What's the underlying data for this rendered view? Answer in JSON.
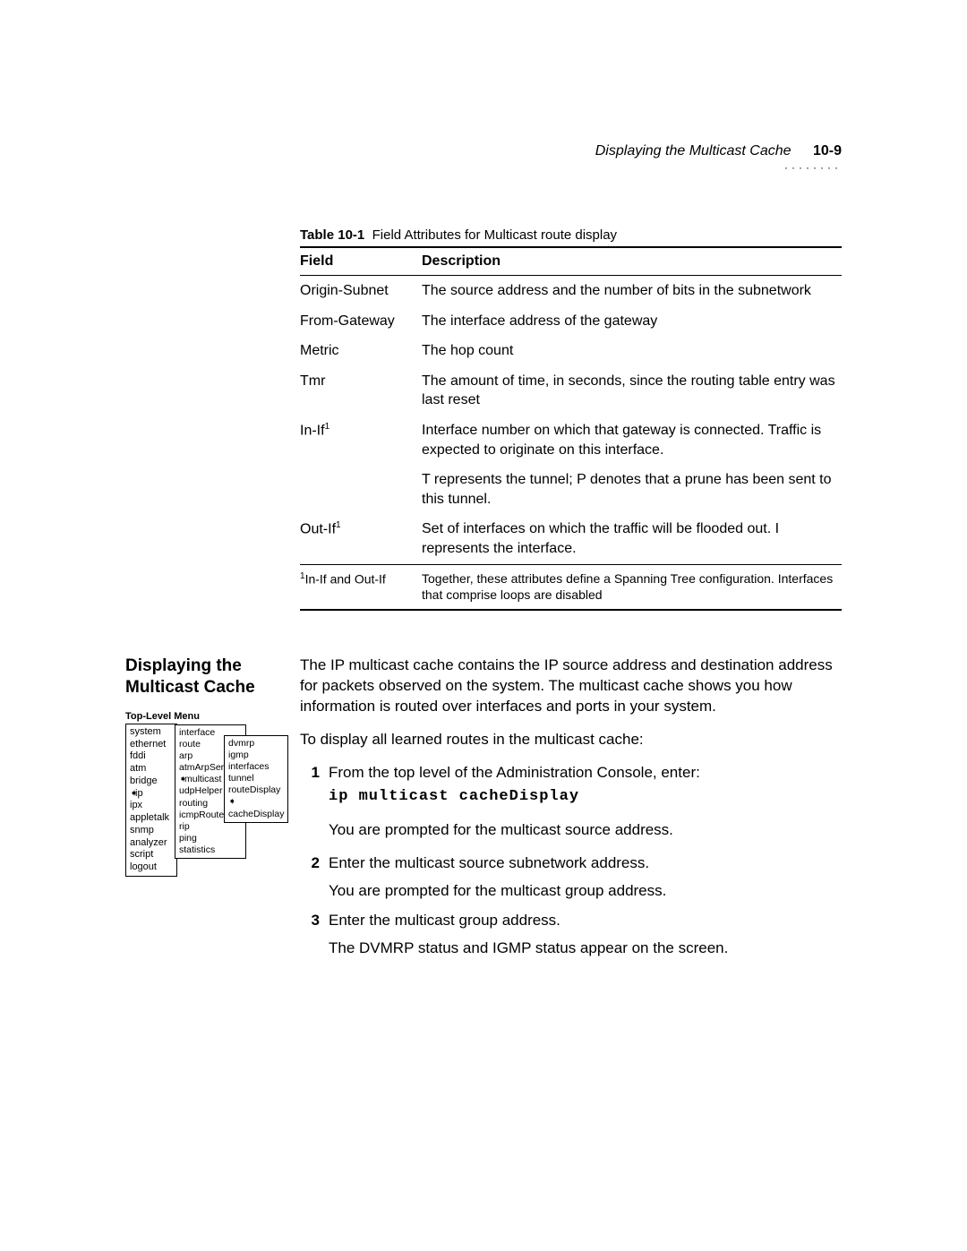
{
  "header": {
    "running": "Displaying the Multicast Cache",
    "page": "10-9",
    "dots": "········"
  },
  "table": {
    "label": "Table 10-1",
    "caption": "Field Attributes for Multicast route display",
    "head_field": "Field",
    "head_desc": "Description",
    "rows": [
      {
        "field": "Origin-Subnet",
        "desc": "The source address and the number of bits in the subnetwork"
      },
      {
        "field": "From-Gateway",
        "desc": "The interface address of the gateway"
      },
      {
        "field": "Metric",
        "desc": "The hop count"
      },
      {
        "field": "Tmr",
        "desc": "The amount of time, in seconds, since the routing table entry was last reset"
      },
      {
        "field": "In-If",
        "sup": "1",
        "desc": "Interface number on which that gateway is connected. Traffic is expected to originate on this interface."
      },
      {
        "field": "",
        "desc": "T represents the tunnel; P denotes that a prune has been sent to this tunnel."
      },
      {
        "field": "Out-If",
        "sup": "1",
        "desc": "Set of interfaces on which the traffic will be flooded out. I represents the interface."
      }
    ],
    "footnote_sup": "1",
    "footnote_field": "In-If and Out-If",
    "footnote_desc": "Together, these attributes define a Spanning Tree configuration. Interfaces that comprise loops are disabled"
  },
  "section": {
    "title": "Displaying the Multicast Cache",
    "intro": "The IP multicast cache contains the IP source address and destination address for packets observed on the system. The multicast cache shows you how information is routed over interfaces and ports in your system.",
    "lead": "To display all learned routes in the multicast cache:",
    "steps": [
      {
        "n": "1",
        "text": "From the top level of the Administration Console, enter:"
      }
    ],
    "cmd": "ip multicast cacheDisplay",
    "after_cmd": "You are prompted for the multicast source address.",
    "step2_n": "2",
    "step2_a": "Enter the multicast source subnetwork address.",
    "step2_b": "You are prompted for the multicast group address.",
    "step3_n": "3",
    "step3_a": "Enter the multicast group address.",
    "step3_b": "The DVMRP status and IGMP status appear on the screen."
  },
  "menu": {
    "title": "Top-Level Menu",
    "col1": [
      "system",
      "ethernet",
      "fddi",
      "atm",
      "bridge",
      "ip",
      "ipx",
      "appletalk",
      "snmp",
      "analyzer",
      "script",
      "logout"
    ],
    "col1_marker_index": 5,
    "col2": [
      "interface",
      "route",
      "arp",
      "atmArpServ",
      "multicast",
      "udpHelper",
      "routing",
      "icmpRouterDiscovery",
      "rip",
      "ping",
      "statistics"
    ],
    "col2_marker_index": 4,
    "col3": [
      "dvmrp",
      "igmp",
      "interfaces",
      "tunnel",
      "routeDisplay",
      "cacheDisplay"
    ],
    "col3_marker_index": 5
  }
}
